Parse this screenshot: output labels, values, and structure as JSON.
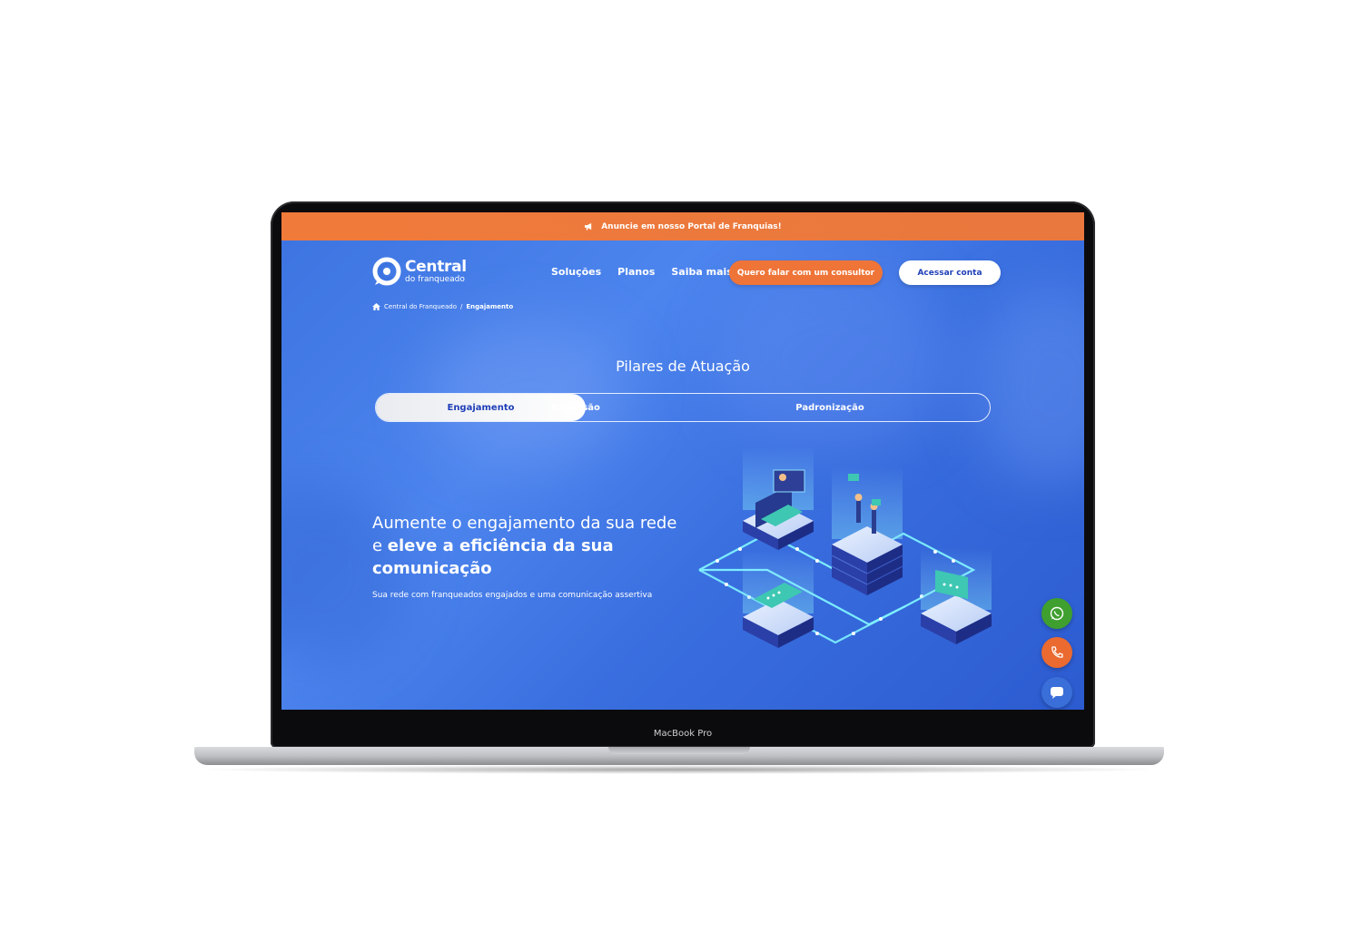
{
  "announcement": {
    "prefix": "Anuncie em nosso",
    "highlight": "Portal de Franquias!"
  },
  "logo": {
    "title": "Central",
    "subtitle": "do franqueado"
  },
  "nav": {
    "items": [
      "Soluções",
      "Planos",
      "Saiba mais"
    ],
    "cta_consultor": "Quero falar com um consultor",
    "cta_conta": "Acessar conta"
  },
  "breadcrumb": {
    "home": "Central do Franqueado",
    "separator": "/",
    "current": "Engajamento"
  },
  "section": {
    "title": "Pilares de Atuação",
    "tabs": [
      {
        "label": "Engajamento",
        "active": true
      },
      {
        "label": "Expansão",
        "active": false
      },
      {
        "label": "Padronização",
        "active": false
      }
    ]
  },
  "hero": {
    "headline_part1": "Aumente o engajamento da sua rede",
    "headline_part2_prefix": "e ",
    "headline_part2_bold": "eleve a eficiência da sua comunicação",
    "subtitle": "Sua rede com franqueados engajados e uma comunicação assertiva"
  },
  "floating_actions": [
    {
      "icon": "whatsapp-icon",
      "color": "#3f9f2f"
    },
    {
      "icon": "phone-icon",
      "color": "#ea6a30"
    },
    {
      "icon": "chat-icon",
      "color": "#3a6ed8"
    }
  ],
  "device": {
    "label": "MacBook Pro"
  },
  "colors": {
    "brand_blue": "#3c73e0",
    "accent_orange": "#ef7437",
    "button_text_blue": "#1f3fb8"
  }
}
